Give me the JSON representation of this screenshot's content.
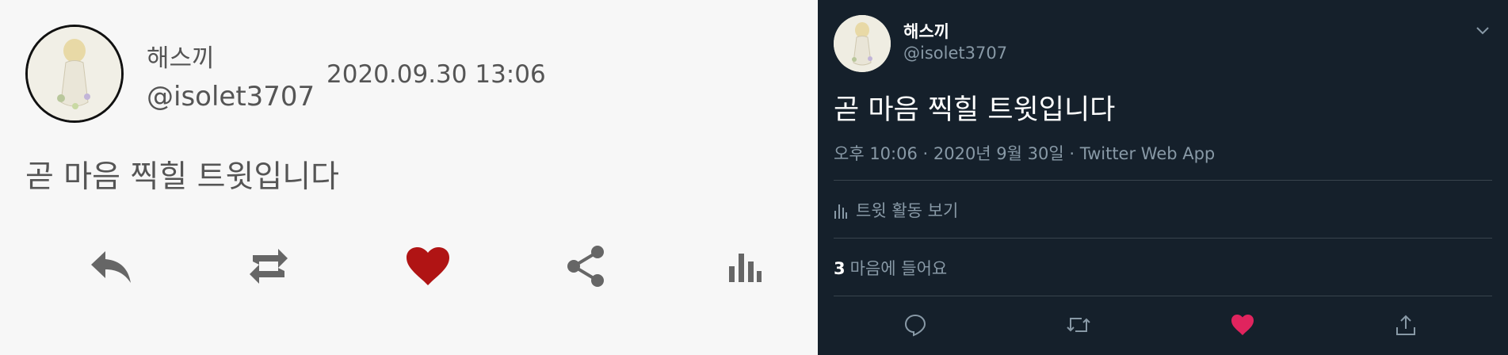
{
  "left_app": {
    "user": {
      "name": "해스끼",
      "handle": "@isolet3707"
    },
    "timestamp": "2020.09.30 13:06",
    "tweet_text": "곧 마음 찍힐 트윗입니다",
    "accent_color": "#b01414",
    "icon_color": "#666666",
    "actions": [
      "reply-icon",
      "retweet-icon",
      "heart-icon",
      "share-icon",
      "stats-icon"
    ],
    "liked": true
  },
  "right_app": {
    "user": {
      "name": "해스끼",
      "handle": "@isolet3707"
    },
    "tweet_text": "곧 마음 찍힐 트윗입니다",
    "meta": "오후 10:06 · 2020년 9월 30일 · Twitter Web App",
    "activity_label": "트윗 활동 보기",
    "likes": {
      "count": "3",
      "label": "마음에 들어요"
    },
    "background": "#15202b",
    "secondary_text": "#8899a6",
    "like_color": "#e0245e",
    "actions": [
      "reply-icon",
      "retweet-icon",
      "heart-icon",
      "share-icon"
    ],
    "liked": true
  }
}
